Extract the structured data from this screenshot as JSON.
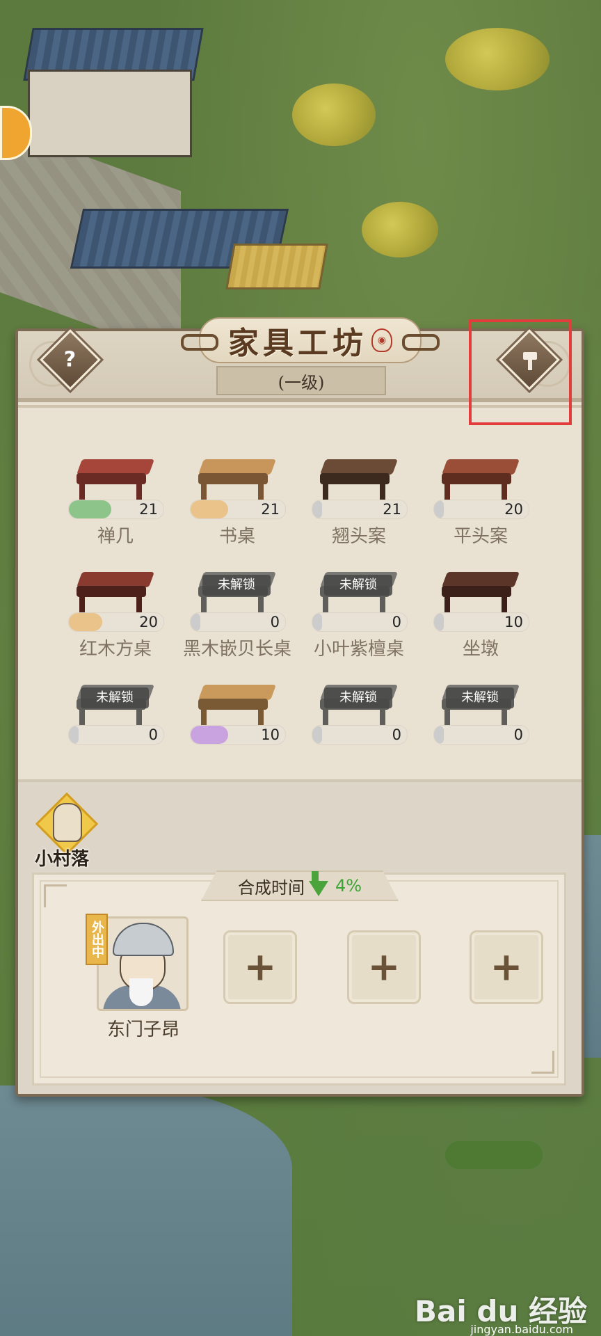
{
  "panel": {
    "title": "家具工坊",
    "level": "(一级)",
    "help_icon": "question-mark-icon",
    "build_icon": "hammer-icon"
  },
  "furniture": [
    {
      "name": "禅几",
      "count": "21",
      "locked": false,
      "progress": 0.45,
      "bar_color": "#8dc48a"
    },
    {
      "name": "书桌",
      "count": "21",
      "locked": false,
      "progress": 0.4,
      "bar_color": "#e9c38a"
    },
    {
      "name": "翘头案",
      "count": "21",
      "locked": false,
      "progress": 0.1,
      "bar_color": "#cccccc"
    },
    {
      "name": "平头案",
      "count": "20",
      "locked": false,
      "progress": 0.1,
      "bar_color": "#cccccc"
    },
    {
      "name": "红木方桌",
      "count": "20",
      "locked": false,
      "progress": 0.35,
      "bar_color": "#e9c38a"
    },
    {
      "name": "黑木嵌贝长桌",
      "count": "0",
      "locked": true,
      "lock_text": "未解锁",
      "progress": 0.1,
      "bar_color": "#cccccc"
    },
    {
      "name": "小叶紫檀桌",
      "count": "0",
      "locked": true,
      "lock_text": "未解锁",
      "progress": 0.1,
      "bar_color": "#cccccc"
    },
    {
      "name": "坐墩",
      "count": "10",
      "locked": false,
      "progress": 0.1,
      "bar_color": "#cccccc"
    },
    {
      "name": "",
      "count": "0",
      "locked": true,
      "lock_text": "未解锁",
      "progress": 0.1,
      "bar_color": "#cccccc"
    },
    {
      "name": "",
      "count": "10",
      "locked": false,
      "progress": 0.4,
      "bar_color": "#c9a3e0"
    },
    {
      "name": "",
      "count": "0",
      "locked": true,
      "lock_text": "未解锁",
      "progress": 0.1,
      "bar_color": "#cccccc"
    },
    {
      "name": "",
      "count": "0",
      "locked": true,
      "lock_text": "未解锁",
      "progress": 0.1,
      "bar_color": "#cccccc"
    }
  ],
  "village": {
    "label": "小村落"
  },
  "synthesis": {
    "label": "合成时间",
    "percent": "4%",
    "worker": {
      "name": "东门子昂",
      "status": "外出中"
    },
    "empty_slot_symbol": "+"
  },
  "colors": {
    "highlight": "#e23c3c",
    "panel_bg": "#e9e2d3",
    "title_text": "#5a3b22",
    "down_arrow": "#4aa33b"
  },
  "watermark": {
    "text": "Bai du 经验",
    "sub": "jingyan.baidu.com"
  }
}
